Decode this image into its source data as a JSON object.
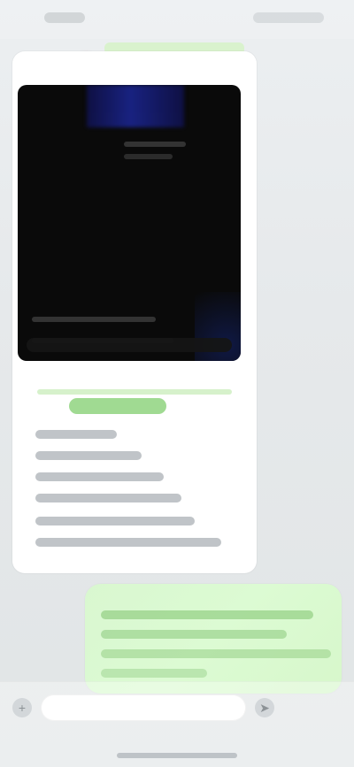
{
  "app": {
    "title": ""
  },
  "composer": {
    "placeholder": "",
    "left_icon": "plus-icon",
    "right_icon": "send-icon"
  },
  "colors": {
    "background": "#e5e8ea",
    "incoming_bubble": "#ffffff",
    "outgoing_bubble": "#d9f7d0",
    "accent_green": "#8fd37f",
    "media_background": "#0a0a0a",
    "media_blue": "#1c2796"
  }
}
